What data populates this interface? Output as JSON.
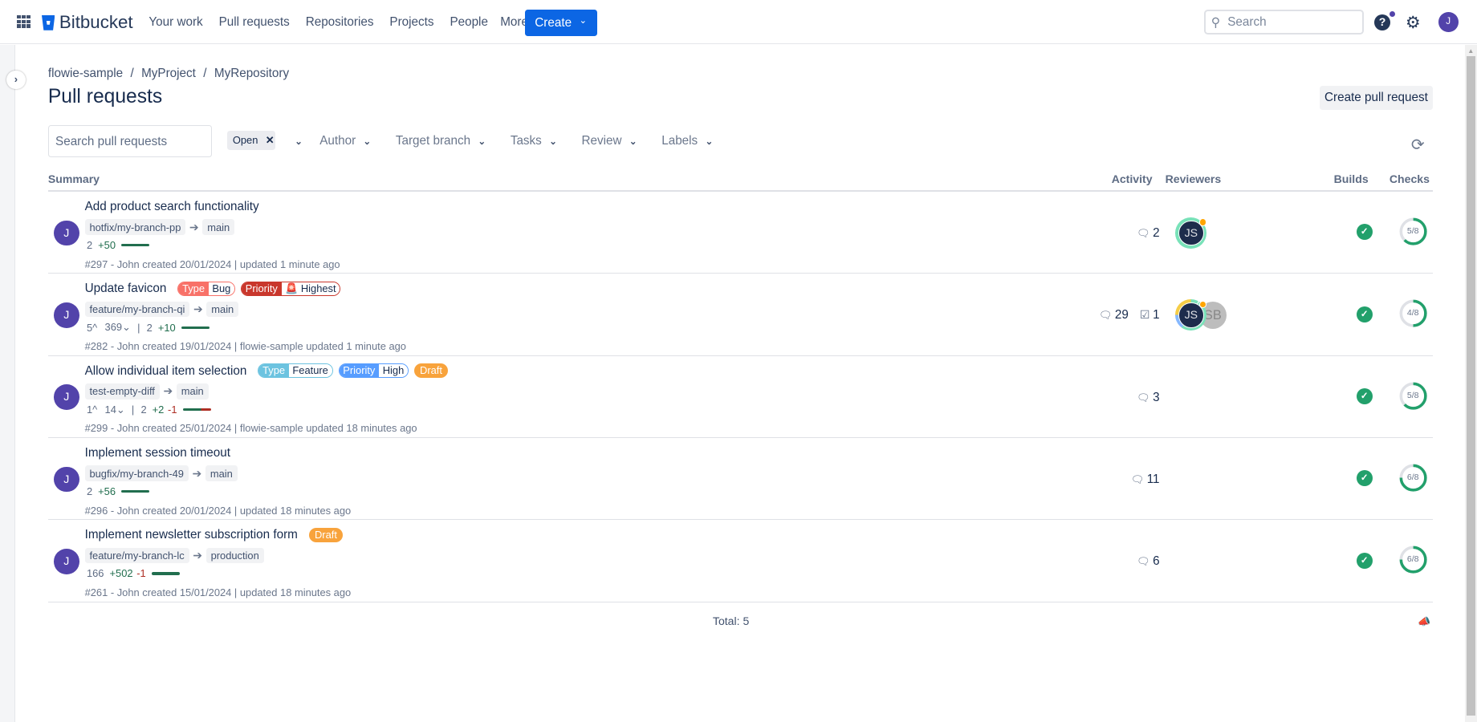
{
  "header": {
    "app": "Bitbucket",
    "nav": [
      "Your work",
      "Pull requests",
      "Repositories",
      "Projects",
      "People",
      "More"
    ],
    "create": "Create",
    "search_placeholder": "Search",
    "user_initial": "J"
  },
  "breadcrumb": [
    "flowie-sample",
    "MyProject",
    "MyRepository"
  ],
  "page_title": "Pull requests",
  "create_pr": "Create pull request",
  "filters": {
    "search_placeholder": "Search pull requests",
    "state": "Open",
    "dropdowns": [
      "Author",
      "Target branch",
      "Tasks",
      "Review",
      "Labels"
    ]
  },
  "columns": {
    "summary": "Summary",
    "activity": "Activity",
    "reviewers": "Reviewers",
    "builds": "Builds",
    "checks": "Checks"
  },
  "colors": {
    "accent": "#0c66e4",
    "success": "#22a06b",
    "avatar": "#5243aa"
  },
  "rows": [
    {
      "title": "Add product search functionality",
      "labels": [],
      "draft": "",
      "source": "hotfix/my-branch-pp",
      "target": "main",
      "commits_ahead": "",
      "commits_behind": "",
      "files": "2",
      "added": "+50",
      "removed": "",
      "meta": "#297 - John created 20/01/2024 | updated 1 minute ago",
      "comments": "2",
      "tasks": "",
      "reviewers": [
        "JS"
      ],
      "checks": {
        "passed": 5,
        "total": 8,
        "label": "5/8"
      },
      "author": "J"
    },
    {
      "title": "Update favicon",
      "labels": [
        {
          "key": "Type",
          "value": "Bug",
          "color": "#f87168"
        },
        {
          "key": "Priority",
          "value": "🚨 Highest",
          "color": "#c9372c"
        }
      ],
      "draft": "",
      "source": "feature/my-branch-qi",
      "target": "main",
      "commits_ahead": "5^",
      "commits_behind": "369⌄",
      "files": "2",
      "added": "+10",
      "removed": "",
      "meta": "#282 - John created 19/01/2024 | flowie-sample updated 1 minute ago",
      "comments": "29",
      "tasks": "1",
      "reviewers": [
        "JS",
        "SB"
      ],
      "checks": {
        "passed": 4,
        "total": 8,
        "label": "4/8"
      },
      "author": "J"
    },
    {
      "title": "Allow individual item selection",
      "labels": [
        {
          "key": "Type",
          "value": "Feature",
          "color": "#6cc3e0"
        },
        {
          "key": "Priority",
          "value": "High",
          "color": "#579dff"
        }
      ],
      "draft": "Draft",
      "source": "test-empty-diff",
      "target": "main",
      "commits_ahead": "1^",
      "commits_behind": "14⌄",
      "files": "2",
      "added": "+2",
      "removed": "-1",
      "meta": "#299 - John created 25/01/2024 | flowie-sample updated 18 minutes ago",
      "comments": "3",
      "tasks": "",
      "reviewers": [],
      "checks": {
        "passed": 5,
        "total": 8,
        "label": "5/8"
      },
      "author": "J"
    },
    {
      "title": "Implement session timeout",
      "labels": [],
      "draft": "",
      "source": "bugfix/my-branch-49",
      "target": "main",
      "commits_ahead": "",
      "commits_behind": "",
      "files": "2",
      "added": "+56",
      "removed": "",
      "meta": "#296 - John created 20/01/2024 | updated 18 minutes ago",
      "comments": "11",
      "tasks": "",
      "reviewers": [],
      "checks": {
        "passed": 6,
        "total": 8,
        "label": "6/8"
      },
      "author": "J"
    },
    {
      "title": "Implement newsletter subscription form",
      "labels": [],
      "draft": "Draft",
      "source": "feature/my-branch-lc",
      "target": "production",
      "commits_ahead": "",
      "commits_behind": "",
      "files": "166",
      "added": "+502",
      "removed": "-1",
      "meta": "#261 - John created 15/01/2024 | updated 18 minutes ago",
      "comments": "6",
      "tasks": "",
      "reviewers": [],
      "checks": {
        "passed": 6,
        "total": 8,
        "label": "6/8"
      },
      "author": "J"
    }
  ],
  "total": "Total: 5"
}
